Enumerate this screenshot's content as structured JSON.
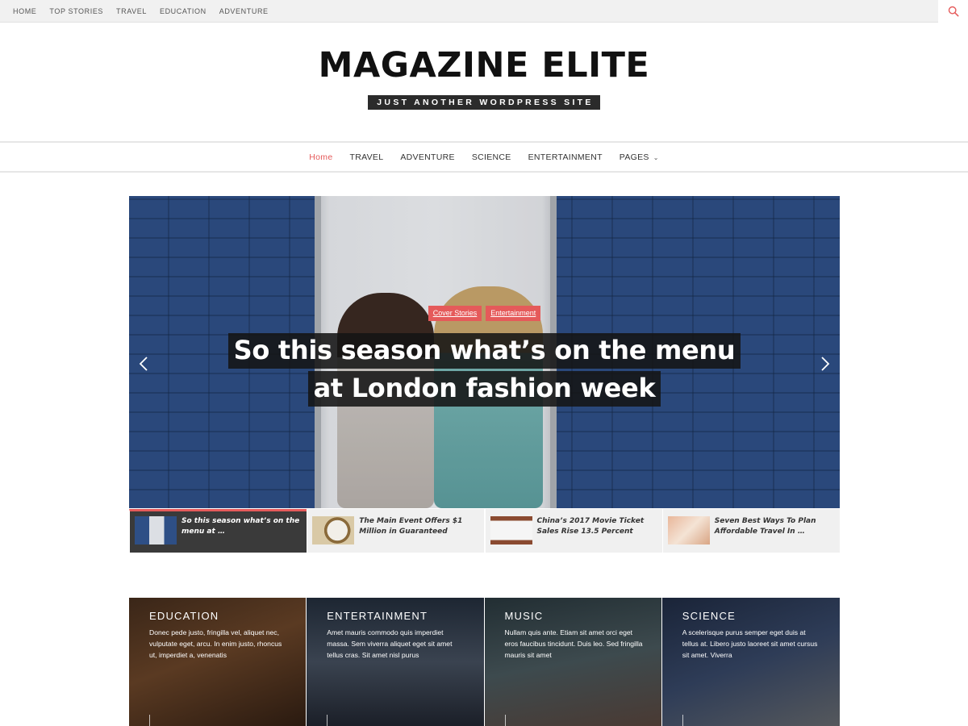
{
  "topbar": {
    "links": [
      "HOME",
      "TOP STORIES",
      "TRAVEL",
      "EDUCATION",
      "ADVENTURE"
    ],
    "search_icon": "search-icon"
  },
  "branding": {
    "title": "MAGAZINE ELITE",
    "tagline": "JUST ANOTHER WORDPRESS SITE"
  },
  "mainnav": {
    "items": [
      "Home",
      "TRAVEL",
      "ADVENTURE",
      "SCIENCE",
      "ENTERTAINMENT",
      "PAGES"
    ],
    "active_color": "#e55a5a"
  },
  "slider": {
    "categories": [
      "Cover Stories",
      "Entertainment"
    ],
    "headline_line1": "So this season what’s on the menu",
    "headline_line2": "at London fashion week",
    "accent_color": "#e55a5a"
  },
  "thumbs": [
    {
      "title": "So this season what’s on the menu at …"
    },
    {
      "title": "The Main Event Offers $1 Million in Guaranteed"
    },
    {
      "title": "China’s 2017 Movie Ticket Sales Rise 13.5 Percent"
    },
    {
      "title": "Seven Best Ways To Plan Affordable Travel In …"
    }
  ],
  "blocks": [
    {
      "title": "EDUCATION",
      "text": "Donec pede justo, fringilla vel, aliquet nec, vulputate eget, arcu. In enim justo, rhoncus ut, imperdiet a, venenatis"
    },
    {
      "title": "ENTERTAINMENT",
      "text": "Amet mauris commodo quis imperdiet massa. Sem viverra aliquet eget sit amet tellus cras. Sit amet nisl purus"
    },
    {
      "title": "MUSIC",
      "text": "Nullam quis ante. Etiam sit amet orci eget eros faucibus tincidunt. Duis leo. Sed fringilla mauris sit amet"
    },
    {
      "title": "SCIENCE",
      "text": "A scelerisque purus semper eget duis at tellus at. Libero justo laoreet sit amet cursus sit amet. Viverra"
    }
  ]
}
